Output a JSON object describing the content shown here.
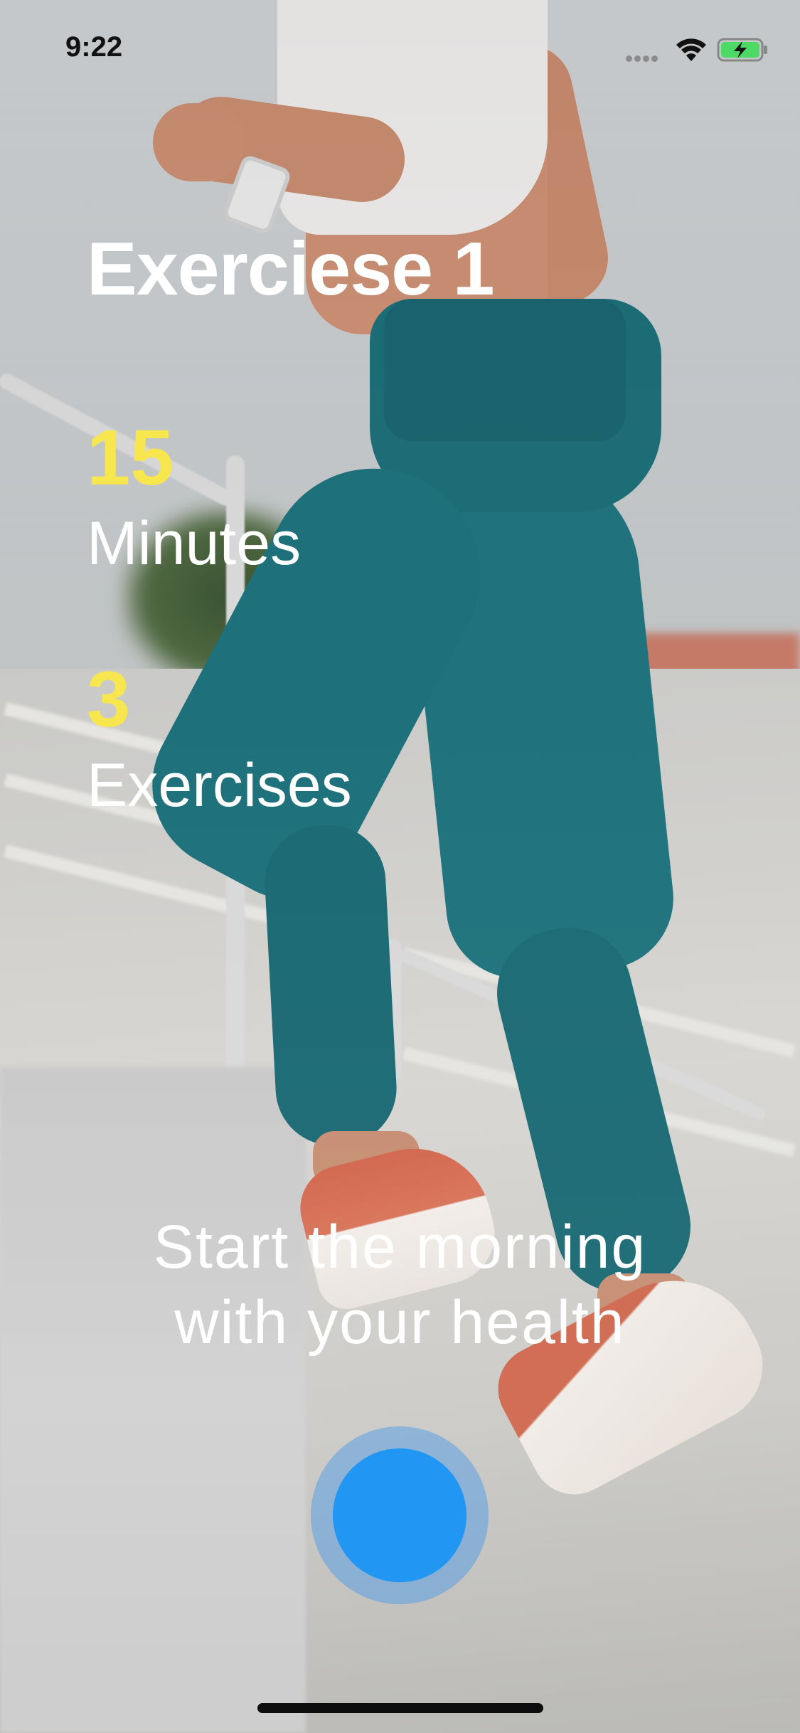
{
  "status_bar": {
    "time": "9:22",
    "wifi_icon": "wifi-icon",
    "battery_icon": "battery-charging-icon"
  },
  "workout": {
    "title": "Exerciese 1",
    "duration_value": "15",
    "duration_label": "Minutes",
    "exercise_count_value": "3",
    "exercise_count_label": "Exercises"
  },
  "tagline": {
    "line1": "Start the morning",
    "line2": "with your health"
  },
  "colors": {
    "accent_yellow": "#f7e64d",
    "button_blue": "#2196f3",
    "battery_green": "#4cd964"
  }
}
